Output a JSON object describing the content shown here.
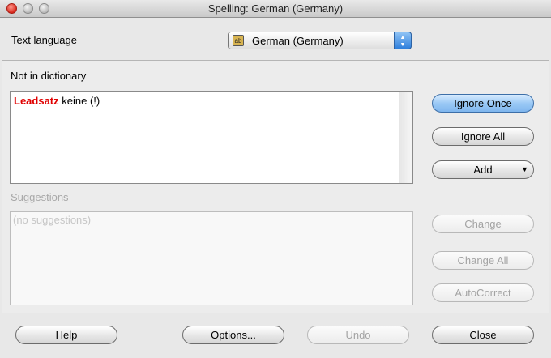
{
  "window": {
    "title": "Spelling: German (Germany)"
  },
  "language": {
    "label": "Text language",
    "selected": "German (Germany)",
    "icon_text": "ab",
    "icon": "language-flag-icon"
  },
  "not_in_dictionary": {
    "label": "Not in dictionary",
    "word": "Leadsatz",
    "context": " keine (!)"
  },
  "suggestions": {
    "label": "Suggestions",
    "placeholder": "(no suggestions)"
  },
  "buttons": {
    "ignore_once": "Ignore Once",
    "ignore_all": "Ignore All",
    "add": "Add",
    "add_arrow": "▼",
    "change": "Change",
    "change_all": "Change All",
    "autocorrect": "AutoCorrect",
    "help": "Help",
    "options": "Options...",
    "undo": "Undo",
    "close": "Close"
  },
  "colors": {
    "misspelled": "#e00000",
    "accent": "#7fb6ee"
  }
}
